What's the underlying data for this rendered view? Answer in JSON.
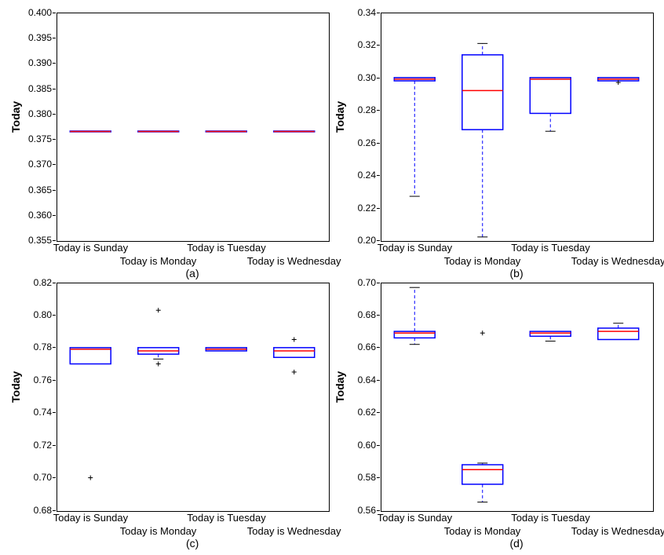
{
  "ylabel": "Today",
  "categories": [
    "Today is Sunday",
    "Today is Monday",
    "Today is Tuesday",
    "Today is Wednesday"
  ],
  "panels": {
    "a": {
      "sub": "(a)",
      "ymin": 0.355,
      "ymax": 0.4,
      "yticks": [
        0.355,
        0.36,
        0.365,
        0.37,
        0.375,
        0.38,
        0.385,
        0.39,
        0.395,
        0.4
      ],
      "yfmt": 3
    },
    "b": {
      "sub": "(b)",
      "ymin": 0.2,
      "ymax": 0.34,
      "yticks": [
        0.2,
        0.22,
        0.24,
        0.26,
        0.28,
        0.3,
        0.32,
        0.34
      ],
      "yfmt": 2
    },
    "c": {
      "sub": "(c)",
      "ymin": 0.68,
      "ymax": 0.82,
      "yticks": [
        0.68,
        0.7,
        0.72,
        0.74,
        0.76,
        0.78,
        0.8,
        0.82
      ],
      "yfmt": 2
    },
    "d": {
      "sub": "(d)",
      "ymin": 0.56,
      "ymax": 0.7,
      "yticks": [
        0.56,
        0.58,
        0.6,
        0.62,
        0.64,
        0.66,
        0.68,
        0.7
      ],
      "yfmt": 2
    }
  },
  "chart_data": [
    {
      "id": "a",
      "type": "boxplot",
      "ylabel": "Today",
      "xlabel": "",
      "ylim": [
        0.355,
        0.4
      ],
      "categories": [
        "Today is Sunday",
        "Today is Monday",
        "Today is Tuesday",
        "Today is Wednesday"
      ],
      "boxes": [
        {
          "q1": 0.3765,
          "median": 0.3765,
          "q3": 0.3765,
          "whisker_low": 0.3765,
          "whisker_high": 0.3765,
          "fliers": []
        },
        {
          "q1": 0.3765,
          "median": 0.3765,
          "q3": 0.3765,
          "whisker_low": 0.3765,
          "whisker_high": 0.3765,
          "fliers": []
        },
        {
          "q1": 0.3765,
          "median": 0.3765,
          "q3": 0.3765,
          "whisker_low": 0.3765,
          "whisker_high": 0.3765,
          "fliers": []
        },
        {
          "q1": 0.3765,
          "median": 0.3765,
          "q3": 0.3765,
          "whisker_low": 0.3765,
          "whisker_high": 0.3765,
          "fliers": []
        }
      ]
    },
    {
      "id": "b",
      "type": "boxplot",
      "ylabel": "Today",
      "xlabel": "",
      "ylim": [
        0.2,
        0.34
      ],
      "categories": [
        "Today is Sunday",
        "Today is Monday",
        "Today is Tuesday",
        "Today is Wednesday"
      ],
      "boxes": [
        {
          "q1": 0.298,
          "median": 0.299,
          "q3": 0.3,
          "whisker_low": 0.227,
          "whisker_high": 0.3,
          "fliers": []
        },
        {
          "q1": 0.268,
          "median": 0.292,
          "q3": 0.314,
          "whisker_low": 0.202,
          "whisker_high": 0.321,
          "fliers": []
        },
        {
          "q1": 0.278,
          "median": 0.299,
          "q3": 0.3,
          "whisker_low": 0.267,
          "whisker_high": 0.3,
          "fliers": []
        },
        {
          "q1": 0.298,
          "median": 0.299,
          "q3": 0.3,
          "whisker_low": 0.298,
          "whisker_high": 0.3,
          "fliers": [
            0.297
          ]
        }
      ]
    },
    {
      "id": "c",
      "type": "boxplot",
      "ylabel": "Today",
      "xlabel": "",
      "ylim": [
        0.68,
        0.82
      ],
      "categories": [
        "Today is Sunday",
        "Today is Monday",
        "Today is Tuesday",
        "Today is Wednesday"
      ],
      "boxes": [
        {
          "q1": 0.77,
          "median": 0.779,
          "q3": 0.78,
          "whisker_low": 0.77,
          "whisker_high": 0.78,
          "fliers": [
            0.7
          ]
        },
        {
          "q1": 0.776,
          "median": 0.778,
          "q3": 0.78,
          "whisker_low": 0.773,
          "whisker_high": 0.78,
          "fliers": [
            0.77,
            0.803
          ]
        },
        {
          "q1": 0.778,
          "median": 0.779,
          "q3": 0.78,
          "whisker_low": 0.778,
          "whisker_high": 0.78,
          "fliers": []
        },
        {
          "q1": 0.774,
          "median": 0.778,
          "q3": 0.78,
          "whisker_low": 0.774,
          "whisker_high": 0.78,
          "fliers": [
            0.765,
            0.785
          ]
        }
      ]
    },
    {
      "id": "d",
      "type": "boxplot",
      "ylabel": "Today",
      "xlabel": "",
      "ylim": [
        0.56,
        0.7
      ],
      "categories": [
        "Today is Sunday",
        "Today is Monday",
        "Today is Tuesday",
        "Today is Wednesday"
      ],
      "boxes": [
        {
          "q1": 0.666,
          "median": 0.669,
          "q3": 0.67,
          "whisker_low": 0.662,
          "whisker_high": 0.697,
          "fliers": []
        },
        {
          "q1": 0.576,
          "median": 0.585,
          "q3": 0.588,
          "whisker_low": 0.565,
          "whisker_high": 0.589,
          "fliers": [
            0.669
          ]
        },
        {
          "q1": 0.667,
          "median": 0.669,
          "q3": 0.67,
          "whisker_low": 0.664,
          "whisker_high": 0.67,
          "fliers": []
        },
        {
          "q1": 0.665,
          "median": 0.67,
          "q3": 0.672,
          "whisker_low": 0.665,
          "whisker_high": 0.675,
          "fliers": []
        }
      ]
    }
  ]
}
